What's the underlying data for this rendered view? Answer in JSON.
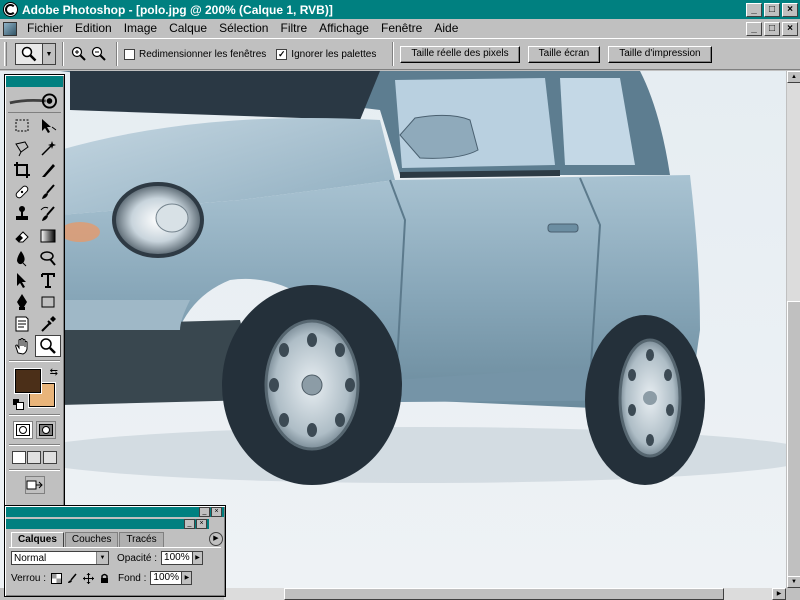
{
  "window": {
    "title": "Adobe Photoshop - [polo.jpg @ 200% (Calque 1, RVB)]",
    "controls": [
      "_",
      "□",
      "×"
    ]
  },
  "menu": {
    "items": [
      "Fichier",
      "Edition",
      "Image",
      "Calque",
      "Sélection",
      "Filtre",
      "Affichage",
      "Fenêtre",
      "Aide"
    ],
    "doc_controls": [
      "_",
      "□",
      "×"
    ]
  },
  "options": {
    "resize_windows": {
      "label": "Redimensionner les fenêtres",
      "checked": false
    },
    "ignore_palettes": {
      "label": "Ignorer les palettes",
      "checked": true
    },
    "buttons": [
      "Taille réelle des pixels",
      "Taille écran",
      "Taille d'impression"
    ],
    "check_mark": "✓"
  },
  "toolbox": {
    "foreground_color": "#4b2f18",
    "background_color": "#e8b47a",
    "active_tool": "zoom-tool"
  },
  "layers_palette": {
    "tabs": [
      "Calques",
      "Couches",
      "Tracés"
    ],
    "active_tab": "Calques",
    "blend_mode": "Normal",
    "opacity_label": "Opacité :",
    "opacity_value": "100%",
    "lock_label": "Verrou :",
    "fill_label": "Fond :",
    "fill_value": "100%"
  },
  "colors": {
    "titlebar": "#008080",
    "chrome": "#c0c0c0"
  }
}
